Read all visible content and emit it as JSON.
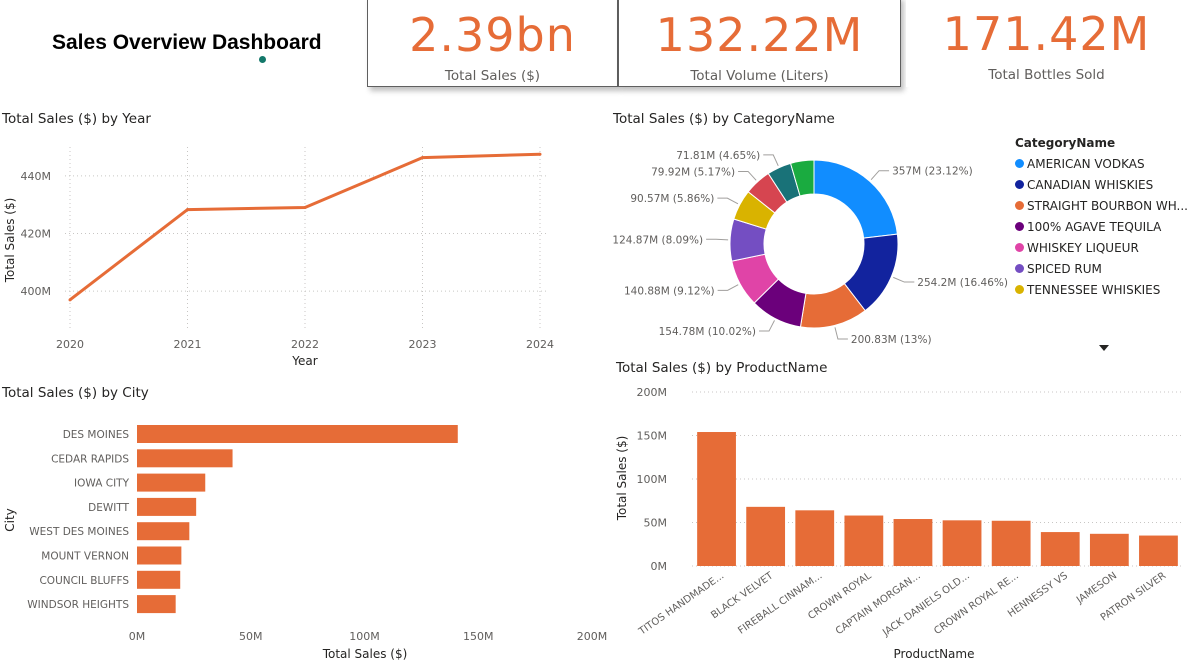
{
  "dashboard": {
    "title": "Sales Overview Dashboard"
  },
  "kpis": [
    {
      "value": "2.39bn",
      "label": "Total Sales ($)"
    },
    {
      "value": "132.22M",
      "label": "Total Volume (Liters)"
    },
    {
      "value": "171.42M",
      "label": "Total Bottles Sold"
    }
  ],
  "colors": {
    "accent": "#e66c37",
    "grid": "#c8c6c4",
    "axis_text": "#605e5c"
  },
  "chart_data": [
    {
      "type": "line",
      "title": "Total Sales ($) by Year",
      "xlabel": "Year",
      "ylabel": "Total Sales ($)",
      "x": [
        "2020",
        "2021",
        "2022",
        "2023",
        "2024"
      ],
      "values": [
        397,
        428.3,
        429,
        446.3,
        447.5
      ],
      "value_unit": "M",
      "ylim": [
        390,
        450
      ],
      "yticks": [
        400,
        420,
        440
      ],
      "ytick_labels": [
        "400M",
        "420M",
        "440M"
      ],
      "grid": true
    },
    {
      "type": "pie",
      "title": "Total Sales ($) by CategoryName",
      "legend_title": "CategoryName",
      "legend_position": "right",
      "legend_visible_count": 7,
      "slices": [
        {
          "name": "AMERICAN VODKAS",
          "value": 357,
          "label": "357M (23.12%)",
          "color": "#118dff"
        },
        {
          "name": "CANADIAN WHISKIES",
          "value": 254.2,
          "label": "254.2M (16.46%)",
          "color": "#12239e"
        },
        {
          "name": "STRAIGHT BOURBON WH...",
          "value": 200.83,
          "label": "200.83M (13%)",
          "color": "#e66c37"
        },
        {
          "name": "100% AGAVE TEQUILA",
          "value": 154.78,
          "label": "154.78M (10.02%)",
          "color": "#6b007b"
        },
        {
          "name": "WHISKEY LIQUEUR",
          "value": 140.88,
          "label": "140.88M (9.12%)",
          "color": "#e044a7"
        },
        {
          "name": "SPICED RUM",
          "value": 124.87,
          "label": "124.87M (8.09%)",
          "color": "#744ec2"
        },
        {
          "name": "TENNESSEE WHISKIES",
          "value": 90.57,
          "label": "90.57M (5.86%)",
          "color": "#d9b300"
        },
        {
          "name": "",
          "value": 79.92,
          "label": "79.92M (5.17%)",
          "color": "#d64550"
        },
        {
          "name": "",
          "value": 71.81,
          "label": "71.81M (4.65%)",
          "color": "#197278"
        },
        {
          "name": "",
          "value": 69.5,
          "label": "",
          "color": "#1aab40"
        }
      ]
    },
    {
      "type": "bar",
      "orientation": "horizontal",
      "title": "Total Sales ($) by City",
      "xlabel": "Total Sales ($)",
      "ylabel": "City",
      "categories": [
        "DES MOINES",
        "CEDAR RAPIDS",
        "IOWA CITY",
        "DEWITT",
        "WEST DES MOINES",
        "MOUNT VERNON",
        "COUNCIL BLUFFS",
        "WINDSOR HEIGHTS"
      ],
      "values": [
        141,
        42,
        30,
        26,
        23,
        19.5,
        19,
        17
      ],
      "value_unit": "M",
      "xlim": [
        0,
        200
      ],
      "xticks": [
        0,
        50,
        100,
        150,
        200
      ],
      "xtick_labels": [
        "0M",
        "50M",
        "100M",
        "150M",
        "200M"
      ],
      "grid": false
    },
    {
      "type": "bar",
      "orientation": "vertical",
      "title": "Total Sales ($) by ProductName",
      "xlabel": "ProductName",
      "ylabel": "Total Sales ($)",
      "categories": [
        "TITOS HANDMADE...",
        "BLACK VELVET",
        "FIREBALL CINNAM...",
        "CROWN ROYAL",
        "CAPTAIN MORGAN...",
        "JACK DANIELS OLD...",
        "CROWN ROYAL RE...",
        "HENNESSY VS",
        "JAMESON",
        "PATRON SILVER"
      ],
      "values": [
        154,
        68,
        64,
        58,
        54,
        52.5,
        52,
        39,
        37,
        35
      ],
      "value_unit": "M",
      "ylim": [
        0,
        200
      ],
      "yticks": [
        0,
        50,
        100,
        150,
        200
      ],
      "ytick_labels": [
        "0M",
        "50M",
        "100M",
        "150M",
        "200M"
      ],
      "grid": true
    }
  ]
}
